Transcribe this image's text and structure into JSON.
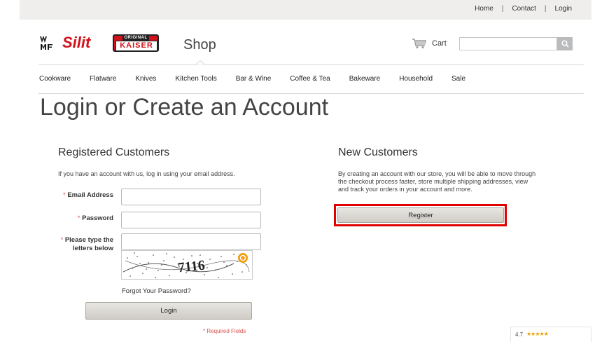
{
  "topbar": {
    "links": [
      "Home",
      "Contact",
      "Login"
    ],
    "separator": "|"
  },
  "brand": {
    "logo_wmf": "WMF",
    "logo_silit": "Silit",
    "logo_kaiser_top": "ORIGINAL",
    "logo_kaiser": "KAISER",
    "section": "Shop"
  },
  "header": {
    "cart_label": "Cart",
    "search_value": "",
    "colors": {
      "search_button": "#b9bbbd",
      "brand_red": "#d1121a"
    }
  },
  "nav": {
    "items": [
      "Cookware",
      "Flatware",
      "Knives",
      "Kitchen Tools",
      "Bar & Wine",
      "Coffee & Tea",
      "Bakeware",
      "Household",
      "Sale"
    ]
  },
  "page": {
    "title": "Login or Create an Account"
  },
  "registered": {
    "title": "Registered Customers",
    "intro": "If you have an account with us, log in using your email address.",
    "required_mark": "*",
    "email_label": "Email Address",
    "email_value": "",
    "password_label": "Password",
    "password_value": "",
    "captcha_label_line1": "Please type the",
    "captcha_label_line2": "letters below",
    "captcha_value": "",
    "captcha_text": "7116",
    "forgot_label": "Forgot Your Password?",
    "login_label": "Login",
    "required_note": "* Required Fields"
  },
  "new_customers": {
    "title": "New Customers",
    "text_line1": "By creating an account with our store, you will be able to move through",
    "text_line2": "the checkout process faster, store multiple shipping addresses, view",
    "text_line3": "and track your orders in your account and more.",
    "register_label": "Register",
    "highlight_color": "#e00000"
  },
  "rating_widget": {
    "score": "4.7",
    "stars": "★★★★★"
  }
}
